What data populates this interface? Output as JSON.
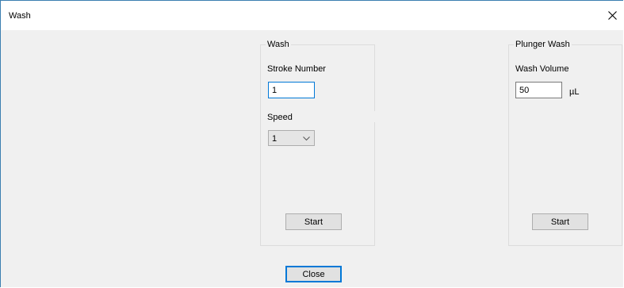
{
  "window": {
    "title": "Wash"
  },
  "wash_group": {
    "title": "Wash",
    "stroke_label": "Stroke Number",
    "stroke_value": "1",
    "speed_label": "Speed",
    "speed_value": "1",
    "start_label": "Start"
  },
  "plunger_group": {
    "title": "Plunger Wash",
    "volume_label": "Wash Volume",
    "volume_value": "50",
    "volume_unit": "µL",
    "start_label": "Start"
  },
  "footer": {
    "close_label": "Close"
  },
  "icons": {
    "close": "close-icon",
    "dropdown": "chevron-down-icon"
  },
  "colors": {
    "accent": "#0078d7",
    "window_border": "#3c7fb1",
    "background": "#f0f0f0"
  }
}
